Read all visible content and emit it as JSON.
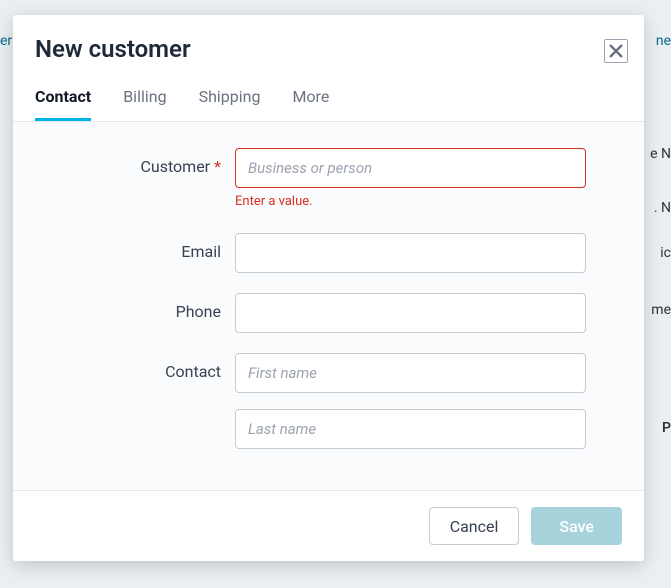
{
  "modal": {
    "title": "New customer",
    "tabs": [
      {
        "label": "Contact"
      },
      {
        "label": "Billing"
      },
      {
        "label": "Shipping"
      },
      {
        "label": "More"
      }
    ],
    "active_tab": 0,
    "form": {
      "customer": {
        "label": "Customer",
        "required_marker": "*",
        "placeholder": "Business or person",
        "value": "",
        "error": "Enter a value."
      },
      "email": {
        "label": "Email",
        "value": ""
      },
      "phone": {
        "label": "Phone",
        "value": ""
      },
      "contact": {
        "label": "Contact",
        "first_name": {
          "placeholder": "First name",
          "value": ""
        },
        "last_name": {
          "placeholder": "Last name",
          "value": ""
        }
      }
    },
    "footer": {
      "cancel_label": "Cancel",
      "save_label": "Save"
    }
  },
  "background": {
    "frag1": "er",
    "frag2": "ne",
    "frag3": "e N",
    "frag4": ". N",
    "frag5": "ic",
    "frag6": "me",
    "frag7": "P"
  }
}
